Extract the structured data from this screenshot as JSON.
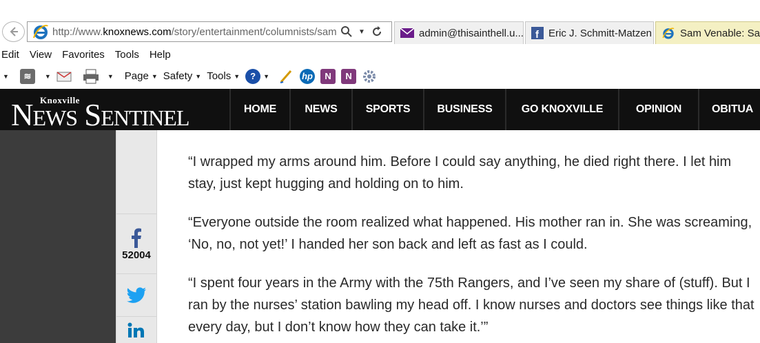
{
  "browser": {
    "address_url_prefix": "http://www.",
    "address_url_domain": "knoxnews.com",
    "address_url_path": "/story/entertainment/columnists/sam",
    "tabs": [
      {
        "label": "admin@thisainthell.u...",
        "icon": "mail-icon"
      },
      {
        "label": "Eric J. Schmitt-Matzen",
        "icon": "facebook-icon"
      },
      {
        "label": "Sam Venable: Sant",
        "icon": "ie-icon"
      }
    ],
    "menu": [
      "Edit",
      "View",
      "Favorites",
      "Tools",
      "Help"
    ],
    "command_bar": {
      "page_label": "Page",
      "safety_label": "Safety",
      "tools_label": "Tools"
    }
  },
  "site": {
    "logo_top": "Knoxville",
    "logo_main": "News Sentinel",
    "nav": [
      "HOME",
      "NEWS",
      "SPORTS",
      "BUSINESS",
      "GO KNOXVILLE",
      "OPINION",
      "OBITUA"
    ]
  },
  "share": {
    "facebook_count": "52004"
  },
  "article": {
    "paragraphs": [
      "“I wrapped my arms around him. Before I could say anything, he died right there. I let him stay, just kept hugging and holding on to him.",
      "“Everyone outside the room realized what happened. His mother ran in. She was screaming, ‘No, no, not yet!’ I handed her son back and left as fast as I could.",
      "“I spent four years in the Army with the 75th Rangers, and I’ve seen my share of (stuff). But I ran by the nurses’ station bawling my head off. I know nurses and doctors see things like that every day, but I don’t know how they can take it.’”"
    ]
  },
  "colors": {
    "header_bg": "#101010",
    "facebook_blue": "#3b5998",
    "twitter_blue": "#1da1f2",
    "linkedin_blue": "#0077b5",
    "active_tab_bg": "#f4f0c3"
  }
}
